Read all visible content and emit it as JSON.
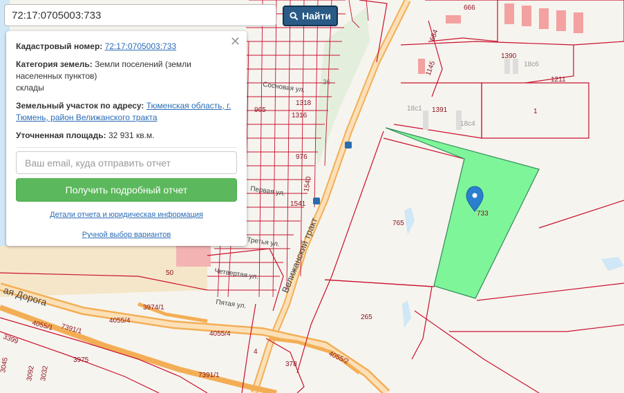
{
  "search": {
    "value": "72:17:0705003:733",
    "button_label": "Найти"
  },
  "panel": {
    "cadastral_label": "Кадастровый номер:",
    "cadastral_value": "72:17:0705003:733",
    "category_label": "Категория земель:",
    "category_value": "Земли поселений (земли населенных пунктов)",
    "category_use": "склады",
    "address_label": "Земельный участок по адресу:",
    "address_value_line1": "Тюменская область, г.",
    "address_value_line2": "Тюмень, район Велижанского тракта",
    "area_label": "Уточненная площадь:",
    "area_value": "32 931 кв.м.",
    "email_placeholder": "Ваш email, куда отправить отчет",
    "report_button": "Получить подробный отчет",
    "details_link": "Детали отчета и юридическая информация",
    "manual_link": "Ручной выбор вариантов"
  },
  "map": {
    "parcel_labels": {
      "p733": "733",
      "p765": "765",
      "p265": "265",
      "p1": "1",
      "p1390": "1390",
      "p1391": "1391",
      "p1211": "1211",
      "p666": "666",
      "p684": "684",
      "p1145": "1145",
      "p18c6": "18с6",
      "p18c1": "18с1",
      "p18c4": "18с4",
      "p1318": "1318",
      "p1316": "1316",
      "p965": "965",
      "p976": "976",
      "p1540": "1540",
      "p1541": "1541",
      "p50": "50",
      "p3974": "3974/1",
      "p4055_4a": "4055/4",
      "p4055_4b": "4055/4",
      "p7391a": "7391/1",
      "p7391b": "7391/1",
      "p4055_1": "4055/1",
      "p3399": "3399",
      "p3975": "3975",
      "p378": "378",
      "p4055_2": "4055/2",
      "p4": "4",
      "p36": "36",
      "p3045": "3045",
      "p3092": "3092",
      "p3032": "3032",
      "p733b": "733"
    },
    "streets": {
      "tract": "Велижанский тракт",
      "doroga": "ая Дорога",
      "pervaya": "Первая ул.",
      "chetvertaya": "Четвертая ул.",
      "pyataya": "Пятая ул.",
      "sosnovaya": "Сосновая ул.",
      "tretya": "Третья ул."
    },
    "colors": {
      "selected_parcel": "#7ff59a",
      "boundary": "#c8102e",
      "road": "#f7c98a",
      "water": "#cfe7f7",
      "marker": "#2b7fcf"
    }
  }
}
